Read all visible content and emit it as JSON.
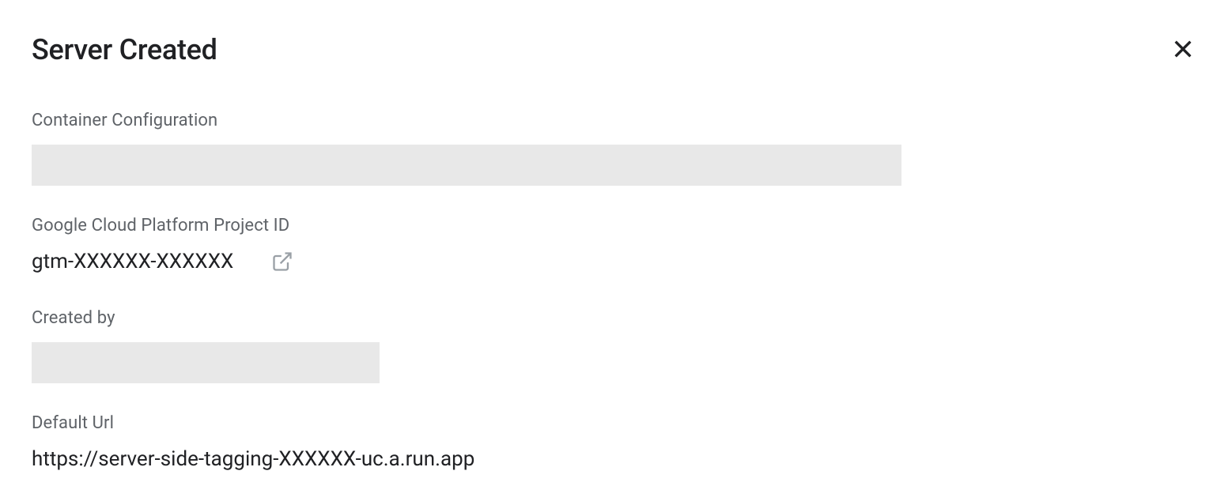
{
  "dialog": {
    "title": "Server Created",
    "fields": {
      "container_config": {
        "label": "Container Configuration",
        "value": ""
      },
      "project_id": {
        "label": "Google Cloud Platform Project ID",
        "value": "gtm-XXXXXX-XXXXXX"
      },
      "created_by": {
        "label": "Created by",
        "value": ""
      },
      "default_url": {
        "label": "Default Url",
        "value": "https://server-side-tagging-XXXXXX-uc.a.run.app"
      }
    }
  }
}
